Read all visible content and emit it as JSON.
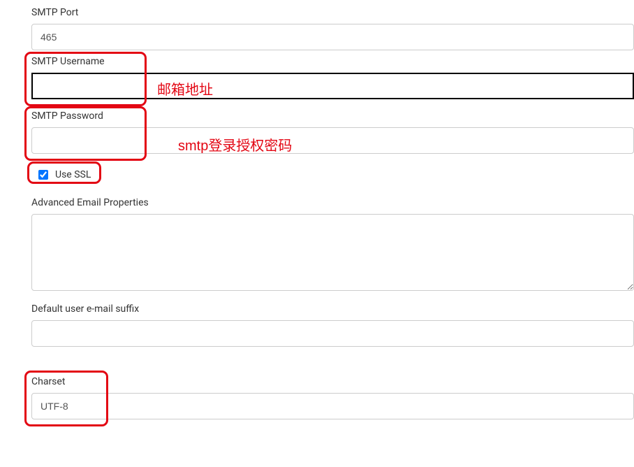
{
  "smtp": {
    "port_label": "SMTP Port",
    "port_value": "465",
    "username_label": "SMTP Username",
    "username_value": "",
    "username_annotation": "邮箱地址",
    "password_label": "SMTP Password",
    "password_value": "",
    "password_annotation": "smtp登录授权密码",
    "use_ssl_label": "Use SSL",
    "use_ssl_checked": true,
    "advanced_label": "Advanced Email Properties",
    "advanced_value": "",
    "suffix_label": "Default user e-mail suffix",
    "suffix_value": "",
    "charset_label": "Charset",
    "charset_value": "UTF-8"
  }
}
